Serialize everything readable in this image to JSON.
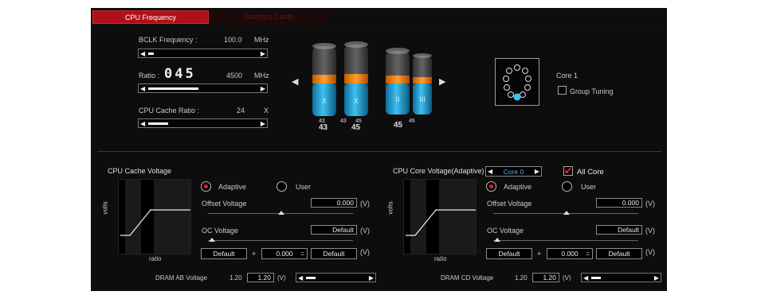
{
  "tabs": [
    {
      "label": "CPU Frequency"
    },
    {
      "label": "Graphics Cards"
    }
  ],
  "freq": {
    "bclk_label": "BCLK Frequency :",
    "bclk_value": "100.0",
    "bclk_unit": "MHz",
    "ratio_label": "Ratio :",
    "ratio_display": "045",
    "ratio_value": "4500",
    "ratio_unit": "MHz",
    "cache_label": "CPU Cache Ratio :",
    "cache_value": "24",
    "cache_unit": "X",
    "bclk_level": 0.05,
    "ratio_level": 0.45,
    "cache_level": 0.18
  },
  "cores": {
    "labels": [
      "X",
      "X",
      "II",
      "III"
    ],
    "top_values": [
      "43",
      "43",
      "45",
      "45"
    ],
    "bottom_values": [
      "43",
      "45",
      "45"
    ],
    "core_label": "Core 1",
    "group_tuning": "Group Tuning"
  },
  "left": {
    "title": "CPU Cache Voltage",
    "adaptive": "Adaptive",
    "user": "User",
    "offset_label": "Offset Voltage",
    "offset_value": "0.000",
    "offset_unit": "(V)",
    "oc_label": "OC Voltage",
    "oc_value": "Default",
    "oc_unit": "(V)",
    "sum_a": "Default",
    "plus": "+",
    "sum_b": "0.000",
    "eq": "=",
    "sum_c": "Default",
    "sum_unit": "(V)",
    "ylabel": "volts",
    "xlabel": "ratio",
    "dram_label": "DRAM AB Voltage",
    "dram_value": "1.20",
    "dram_box": "1.20",
    "dram_unit": "(V)"
  },
  "right": {
    "title": "CPU Core Voltage(Adaptive)",
    "core_select": "Core 0",
    "all_core": "All Core",
    "adaptive": "Adaptive",
    "user": "User",
    "offset_label": "Offset Voltage",
    "offset_value": "0.000",
    "offset_unit": "(V)",
    "oc_label": "OC Voltage",
    "oc_value": "Default",
    "oc_unit": "(V)",
    "sum_a": "Default",
    "plus": "+",
    "sum_b": "0.000",
    "eq": "=",
    "sum_c": "Default",
    "sum_unit": "(V)",
    "ylabel": "volts",
    "xlabel": "ratio",
    "dram_label": "DRAM CD Voltage",
    "dram_value": "1.20",
    "dram_box": "1.20",
    "dram_unit": "(V)"
  },
  "icons": {
    "left_arrow": "triangle-left",
    "right_arrow": "triangle-right",
    "check": "check-mark"
  },
  "colors": {
    "accent": "#b0101a",
    "liquid": "#1aa0d8",
    "band": "#ff8a10"
  }
}
